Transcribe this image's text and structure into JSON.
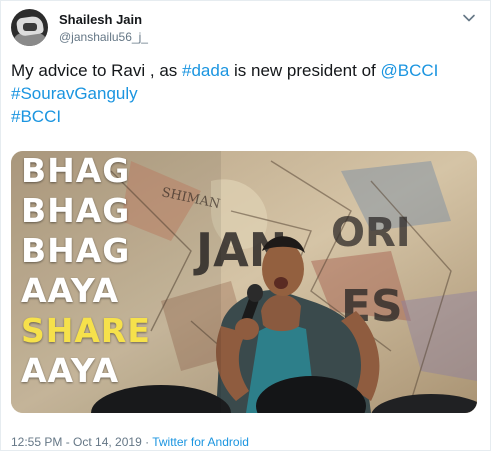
{
  "tweet": {
    "author_name": "Shailesh Jain",
    "author_handle": "@janshailu56_j_",
    "text": {
      "line1_prefix": "My advice to Ravi , as ",
      "hashtag_dada": "#dada",
      "line1_middle": " is new president of ",
      "mention_bcci": "@BCCI",
      "hashtag_sourav": "#SouravGanguly",
      "hashtag_bcci": "#BCCI"
    },
    "media": {
      "overlay_lines": [
        "BHAG",
        "BHAG",
        "BHAG",
        "AAYA",
        "SHARE",
        "AAYA"
      ],
      "highlight_color": "#f6e14b"
    },
    "meta": {
      "timestamp": "12:55 PM - Oct 14, 2019",
      "separator": " · ",
      "source": "Twitter for Android"
    },
    "icons": {
      "menu": "chevron-down-icon",
      "avatar": "avatar"
    },
    "colors": {
      "link": "#1b95e0",
      "secondary_text": "#657786",
      "primary_text": "#14171a"
    }
  }
}
